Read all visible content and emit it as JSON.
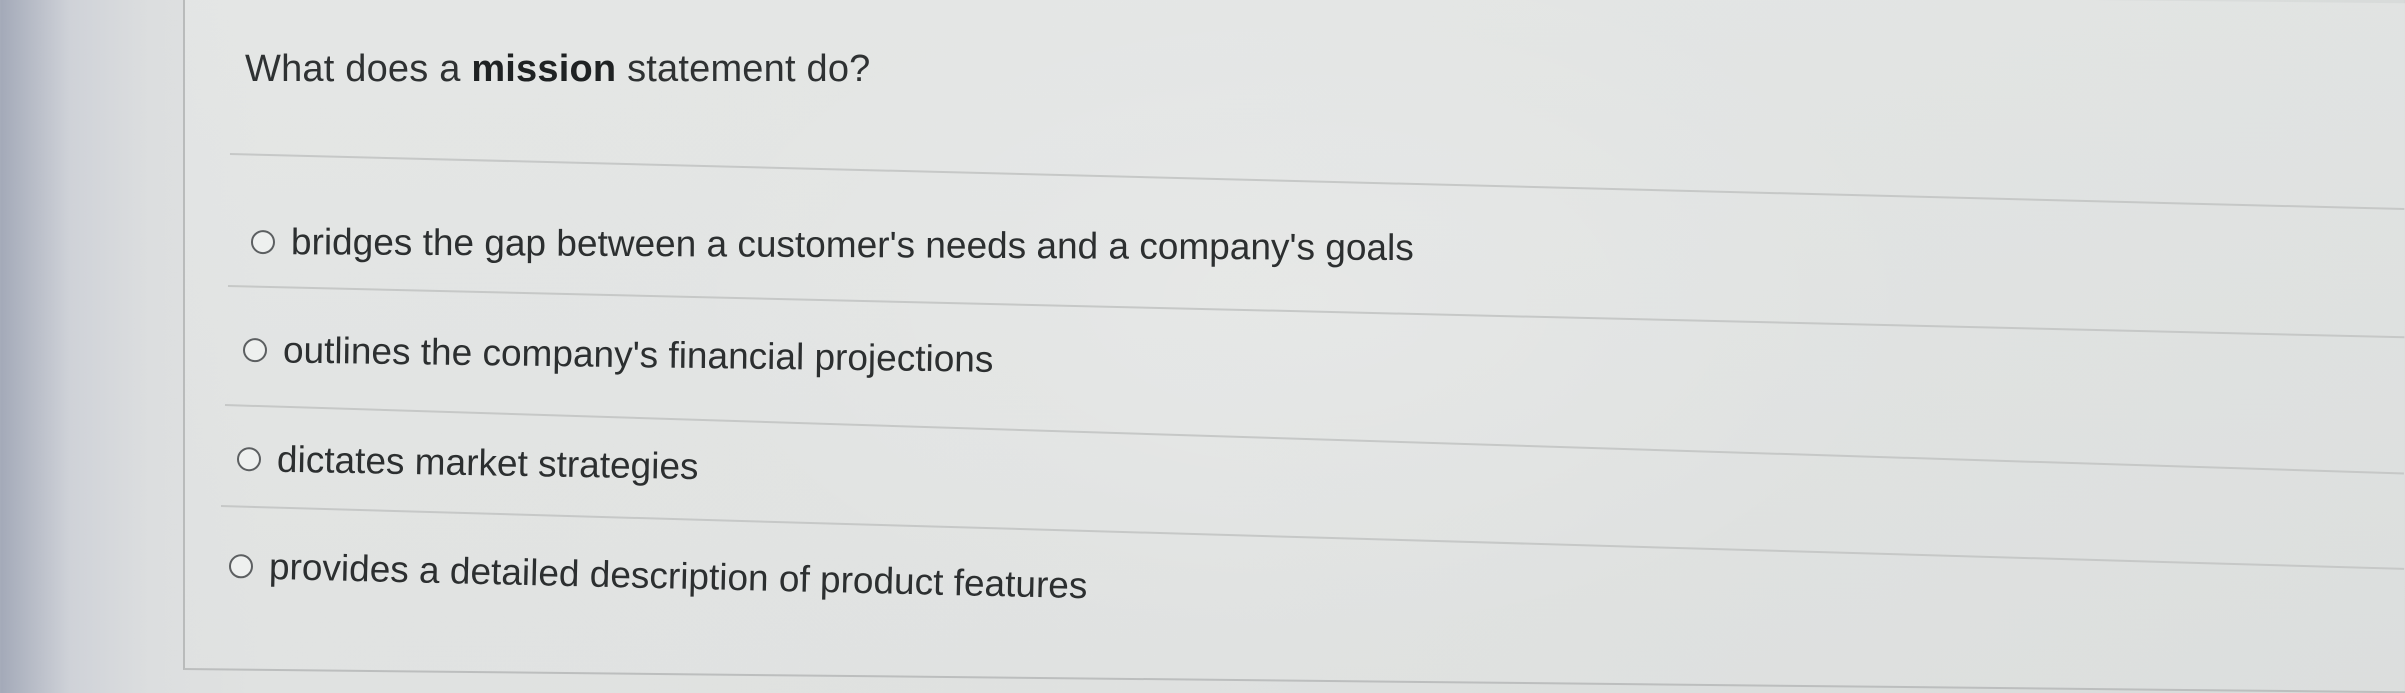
{
  "question": {
    "prefix": "What does a ",
    "bold": "mission",
    "suffix": " statement do?"
  },
  "options": [
    {
      "label": "bridges the gap between a customer's needs and a company's goals",
      "selected": false
    },
    {
      "label": "outlines the company's financial projections",
      "selected": false
    },
    {
      "label": "dictates market strategies",
      "selected": false
    },
    {
      "label": "provides a detailed description of product features",
      "selected": false
    }
  ]
}
